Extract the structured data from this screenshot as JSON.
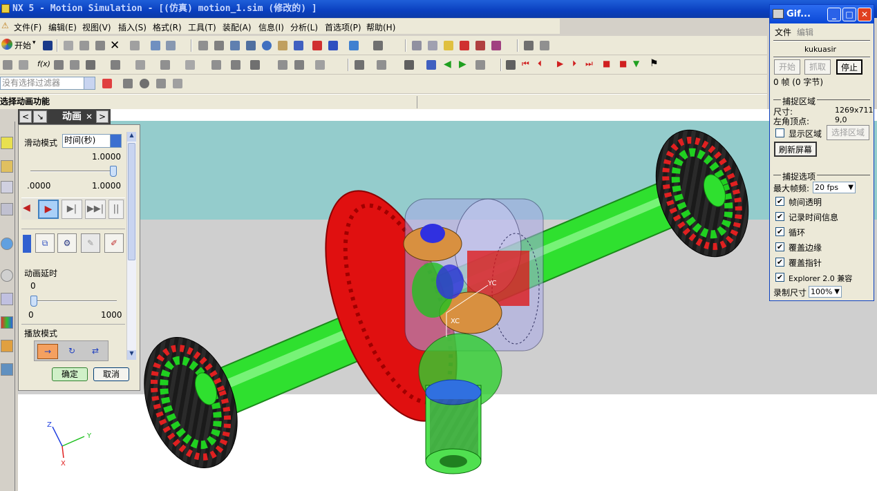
{
  "window": {
    "title": "NX 5 - Motion Simulation - [(仿真) motion_1.sim (修改的) ]"
  },
  "menu": [
    "文件(F)",
    "编辑(E)",
    "视图(V)",
    "插入(S)",
    "格式(R)",
    "工具(T)",
    "装配(A)",
    "信息(I)",
    "分析(L)",
    "首选项(P)",
    "帮助(H)"
  ],
  "toolbar": {
    "start_label": "开始"
  },
  "filter": {
    "placeholder": "没有选择过滤器"
  },
  "cue_line": {
    "text": "选择动画功能"
  },
  "dialog": {
    "title": "动画",
    "slide_mode_label": "滑动模式",
    "slide_mode_value": "时间(秒)",
    "slider_value": "1.0000",
    "slider_min": ".0000",
    "slider_max": "1.0000",
    "slider_fraction": 1.0,
    "delay_label": "动画延时",
    "delay_value": "0",
    "delay_min": "0",
    "delay_max": "1000",
    "delay_fraction": 0.0,
    "play_mode_label": "播放模式",
    "ok_label": "确定",
    "cancel_label": "取消"
  },
  "gif_window": {
    "title": "Gif...",
    "menu_file": "文件",
    "menu_edit": "编辑",
    "author": "kukuasir",
    "start_btn": "开始",
    "capture_btn": "抓取",
    "stop_btn": "停止",
    "frames_text": "0 帧 (0 字节)",
    "capture_area_header": "捕捉区域",
    "size_label": "尺寸:",
    "size_value": "1269x711",
    "corner_label": "左角顶点:",
    "corner_value": "9,0",
    "show_area_label": "显示区域",
    "select_area_btn": "选择区域",
    "refresh_btn": "刷新屏幕",
    "capture_options_header": "捕捉选项",
    "max_fps_label": "最大帧频:",
    "fps_value": "20 fps",
    "options": [
      "帧间透明",
      "记录时间信息",
      "循环",
      "覆盖边缘",
      "覆盖指针",
      "Explorer 2.0 兼容"
    ],
    "record_size_label": "录制尺寸",
    "record_size_value": "100%"
  },
  "triad": {
    "x": "X",
    "y": "Y",
    "z": "Z"
  },
  "model_labels": {
    "yc": "YC",
    "xc": "XC"
  },
  "colors": {
    "title_blue": "#0a3fbf",
    "sky": "#94cccc",
    "floor": "#cfcfcf",
    "shaft": "#2fe02f",
    "gear": "#e01010"
  }
}
